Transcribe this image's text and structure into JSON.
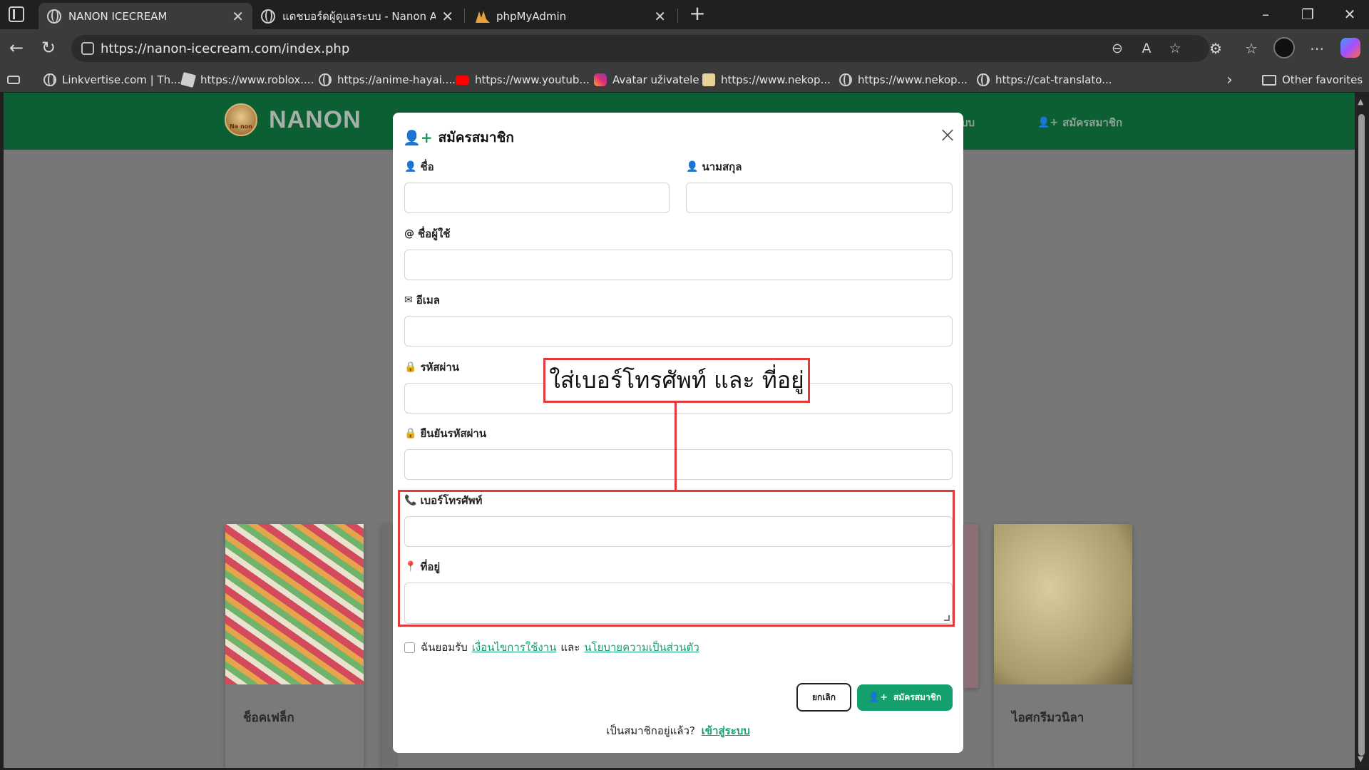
{
  "browser": {
    "tabs": [
      {
        "title": "NANON ICECREAM",
        "active": true
      },
      {
        "title": "แดชบอร์ดผู้ดูแลระบบ - Nanon Admin",
        "active": false
      },
      {
        "title": "phpMyAdmin",
        "active": false
      }
    ],
    "url": "https://nanon-icecream.com/index.php",
    "favorites": [
      {
        "label": "Linkvertise.com | Th...",
        "icon": "globe-icon"
      },
      {
        "label": "https://www.roblox....",
        "icon": "roblox-icon"
      },
      {
        "label": "https://anime-hayai....",
        "icon": "globe-icon"
      },
      {
        "label": "https://www.youtub...",
        "icon": "youtube-icon"
      },
      {
        "label": "Avatar uživatele",
        "icon": "instagram-icon"
      },
      {
        "label": "https://www.nekop...",
        "icon": "cat-icon"
      },
      {
        "label": "https://www.nekop...",
        "icon": "globe-icon"
      },
      {
        "label": "https://cat-translato...",
        "icon": "globe-icon"
      }
    ],
    "other_favorites": "Other favorites"
  },
  "site": {
    "brand": "NANON",
    "logo_text": "Na non",
    "nav_fragment": "บบ",
    "nav_register": "สมัครสมาชิก"
  },
  "products": [
    {
      "name": "ช็อคเฟล็ก"
    },
    {
      "name": "ไอศกรีมวนิลา"
    }
  ],
  "modal": {
    "title": "สมัครสมาชิก",
    "fields": {
      "first_name": "ชื่อ",
      "last_name": "นามสกุล",
      "username": "ชื่อผู้ใช้",
      "email": "อีเมล",
      "password": "รหัสผ่าน",
      "confirm_password": "ยืนยันรหัสผ่าน",
      "phone": "เบอร์โทรศัพท์",
      "address": "ที่อยู่"
    },
    "agree_prefix": "ฉันยอมรับ",
    "terms_link": "เงื่อนไขการใช้งาน",
    "agree_and": "และ",
    "privacy_link": "นโยบายความเป็นส่วนตัว",
    "cancel_label": "ยกเลิก",
    "submit_label": "สมัครสมาชิก",
    "login_prompt": "เป็นสมาชิกอยู่แล้ว?",
    "login_link": "เข้าสู่ระบบ"
  },
  "annotation": {
    "text": "ใส่เบอร์โทรศัพท์ และ ที่อยู่",
    "color": "#e03a3a"
  },
  "colors": {
    "header_green": "#0c5f33",
    "accent_green": "#14a06c"
  }
}
